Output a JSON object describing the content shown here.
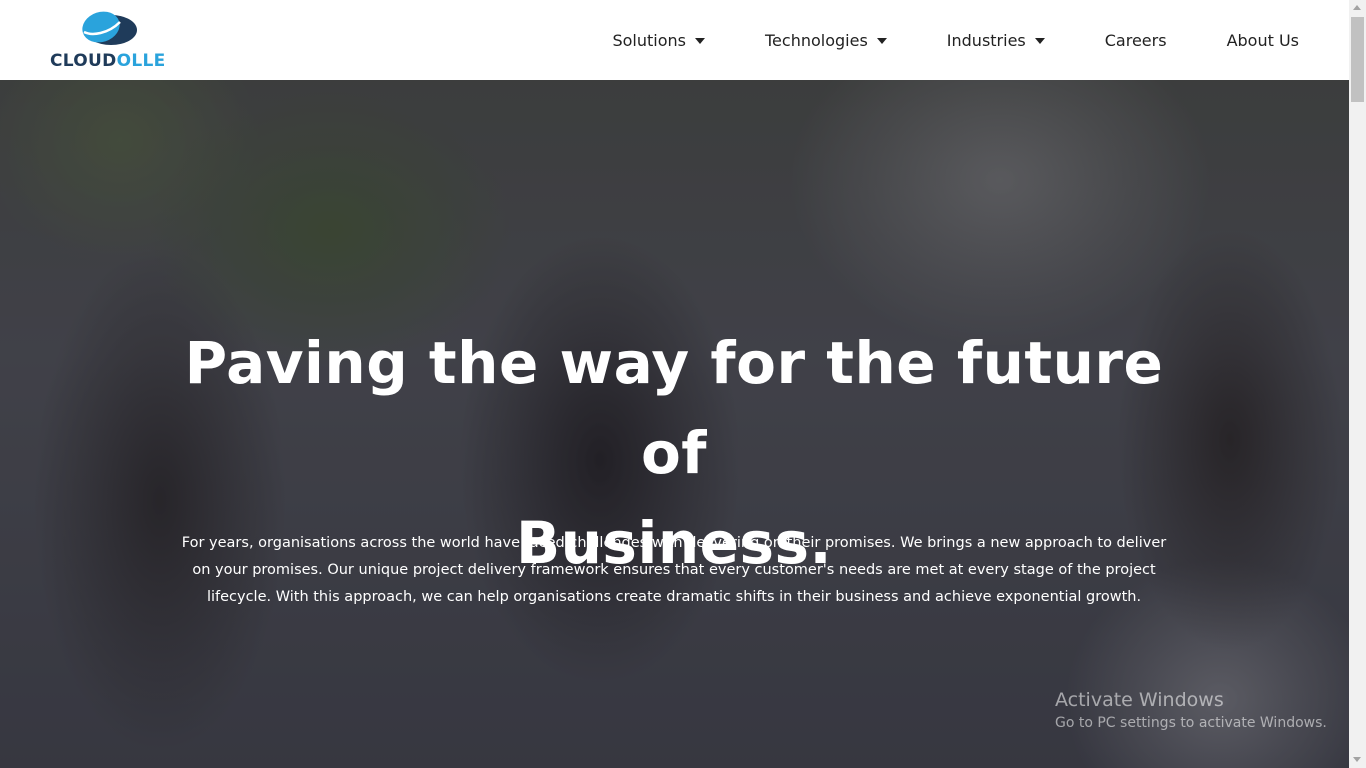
{
  "brand": {
    "name_part1": "CLOUD",
    "name_part2": "OLLE",
    "colors": {
      "dark": "#1f3b5a",
      "light": "#2aa3dc"
    },
    "icon": "cloud-logo-icon"
  },
  "nav": {
    "items": [
      {
        "label": "Solutions",
        "dropdown": true
      },
      {
        "label": "Technologies",
        "dropdown": true
      },
      {
        "label": "Industries",
        "dropdown": true
      },
      {
        "label": "Careers",
        "dropdown": false
      },
      {
        "label": "About Us",
        "dropdown": false
      }
    ]
  },
  "hero": {
    "title_line1": "Paving the way for the future of",
    "title_line2": "Business.",
    "description": "For years, organisations across the world have faced challenges with delivering on their promises. We brings a new approach to deliver on your promises. Our unique project delivery framework ensures that every customer's needs are met at every stage of the project lifecycle. With this approach, we can help organisations create dramatic shifts in their business and achieve exponential growth."
  },
  "watermark": {
    "title": "Activate Windows",
    "subtitle": "Go to PC settings to activate Windows."
  }
}
